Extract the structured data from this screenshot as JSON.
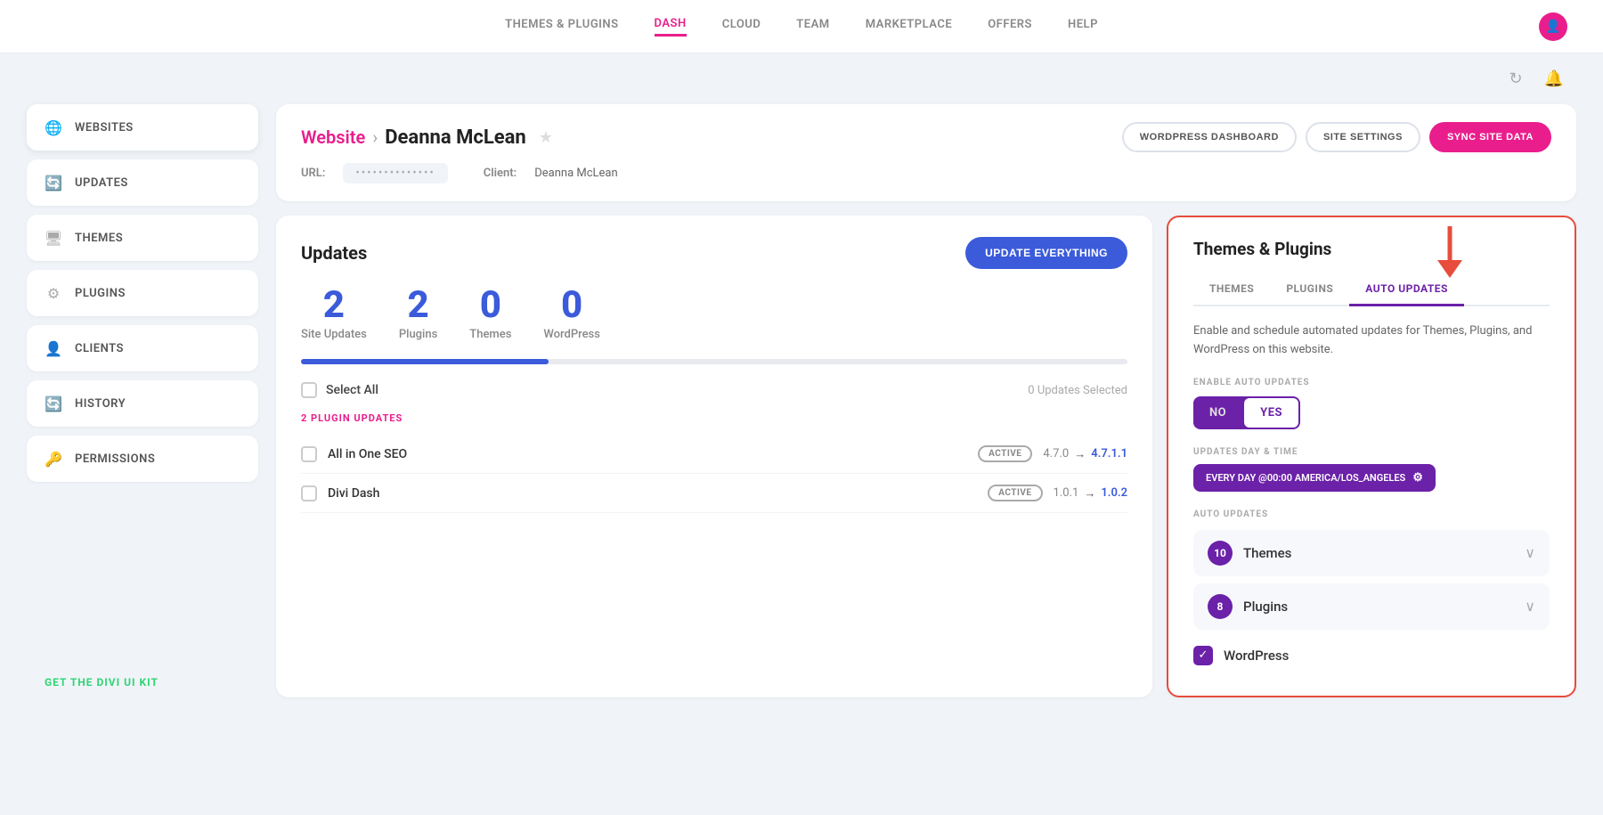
{
  "nav": {
    "links": [
      {
        "label": "THEMES & PLUGINS",
        "id": "themes-plugins",
        "active": false
      },
      {
        "label": "DASH",
        "id": "dash",
        "active": true
      },
      {
        "label": "CLOUD",
        "id": "cloud",
        "active": false
      },
      {
        "label": "TEAM",
        "id": "team",
        "active": false
      },
      {
        "label": "MARKETPLACE",
        "id": "marketplace",
        "active": false
      },
      {
        "label": "OFFERS",
        "id": "offers",
        "active": false
      },
      {
        "label": "HELP",
        "id": "help",
        "active": false
      }
    ]
  },
  "sidebar": {
    "items": [
      {
        "label": "WEBSITES",
        "icon": "🌐",
        "id": "websites",
        "active": true
      },
      {
        "label": "UPDATES",
        "icon": "🔄",
        "id": "updates",
        "active": false
      },
      {
        "label": "THEMES",
        "icon": "🖥",
        "id": "themes",
        "active": false
      },
      {
        "label": "PLUGINS",
        "icon": "⚙",
        "id": "plugins",
        "active": false
      },
      {
        "label": "CLIENTS",
        "icon": "👤",
        "id": "clients",
        "active": false
      },
      {
        "label": "HISTORY",
        "icon": "🔄",
        "id": "history",
        "active": false
      },
      {
        "label": "PERMISSIONS",
        "icon": "🔑",
        "id": "permissions",
        "active": false
      }
    ],
    "get_kit": "GET THE DIVI UI KIT"
  },
  "header": {
    "breadcrumb_website": "Website",
    "breadcrumb_sep": ">",
    "site_name": "Deanna McLean",
    "btn_wordpress": "WORDPRESS DASHBOARD",
    "btn_settings": "SITE SETTINGS",
    "btn_sync": "SYNC SITE DATA",
    "url_label": "URL:",
    "url_value": "••••••••••••••",
    "client_label": "Client:",
    "client_value": "Deanna McLean"
  },
  "updates": {
    "title": "Updates",
    "btn_update": "UPDATE EVERYTHING",
    "stats": [
      {
        "num": "2",
        "label": "Site Updates"
      },
      {
        "num": "2",
        "label": "Plugins"
      },
      {
        "num": "0",
        "label": "Themes"
      },
      {
        "num": "0",
        "label": "WordPress"
      }
    ],
    "select_all": "Select All",
    "updates_selected": "0 Updates Selected",
    "plugin_section": "2 PLUGIN UPDATES",
    "plugins": [
      {
        "name": "All in One SEO",
        "status": "ACTIVE",
        "from": "4.7.0",
        "to": "4.7.1.1"
      },
      {
        "name": "Divi Dash",
        "status": "ACTIVE",
        "from": "1.0.1",
        "to": "1.0.2"
      }
    ]
  },
  "themes_plugins_panel": {
    "title": "Themes & Plugins",
    "tabs": [
      {
        "label": "THEMES",
        "active": false
      },
      {
        "label": "PLUGINS",
        "active": false
      },
      {
        "label": "AUTO UPDATES",
        "active": true
      }
    ],
    "description": "Enable and schedule automated updates for Themes, Plugins, and WordPress on this website.",
    "enable_label": "ENABLE AUTO UPDATES",
    "toggle_no": "NO",
    "toggle_yes": "YES",
    "day_time_label": "UPDATES DAY & TIME",
    "schedule": "EVERY DAY @00:00 AMERICA/LOS_ANGELES",
    "auto_updates_label": "AUTO UPDATES",
    "auto_items": [
      {
        "count": "10",
        "name": "Themes",
        "badge_color": "purple"
      },
      {
        "count": "8",
        "name": "Plugins",
        "badge_color": "purple"
      }
    ],
    "wordpress_label": "WordPress"
  }
}
